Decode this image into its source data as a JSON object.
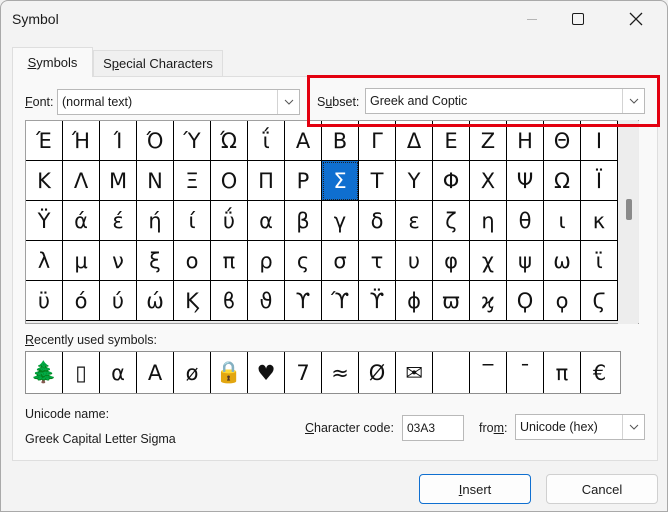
{
  "window": {
    "title": "Symbol",
    "minimize_label": "Minimize",
    "maximize_label": "Maximize",
    "close_label": "Close"
  },
  "tabs": [
    {
      "label_prefix": "",
      "label_u": "S",
      "label_rest": "ymbols",
      "active": true
    },
    {
      "label_prefix": "S",
      "label_u": "p",
      "label_rest": "ecial Characters",
      "active": false
    }
  ],
  "font": {
    "label_u": "F",
    "label_rest": "ont:",
    "value": "(normal text)"
  },
  "subset": {
    "label_prefix": "S",
    "label_u": "u",
    "label_rest": "bset:",
    "value": "Greek and Coptic",
    "highlight_color": "#e3000f"
  },
  "symbol_grid": {
    "selected_index": 24,
    "selected_color": "#0f6fd0",
    "cells": [
      "Έ",
      "Ή",
      "Ί",
      "Ό",
      "Ύ",
      "Ώ",
      "ΐ",
      "Α",
      "Β",
      "Γ",
      "Δ",
      "Ε",
      "Ζ",
      "Η",
      "Θ",
      "Ι",
      "Κ",
      "Λ",
      "Μ",
      "Ν",
      "Ξ",
      "Ο",
      "Π",
      "Ρ",
      "Σ",
      "Τ",
      "Υ",
      "Φ",
      "Χ",
      "Ψ",
      "Ω",
      "Ϊ",
      "Ϋ",
      "ά",
      "έ",
      "ή",
      "ί",
      "ΰ",
      "α",
      "β",
      "γ",
      "δ",
      "ε",
      "ζ",
      "η",
      "θ",
      "ι",
      "κ",
      "λ",
      "μ",
      "ν",
      "ξ",
      "ο",
      "π",
      "ρ",
      "ς",
      "σ",
      "τ",
      "υ",
      "φ",
      "χ",
      "ψ",
      "ω",
      "ϊ",
      "ϋ",
      "ό",
      "ύ",
      "ώ",
      "Ϗ",
      "ϐ",
      "ϑ",
      "ϒ",
      "ϓ",
      "ϔ",
      "ϕ",
      "ϖ",
      "ϗ",
      "Ϙ",
      "ϙ",
      "Ϛ"
    ]
  },
  "recent": {
    "label_u": "R",
    "label_rest": "ecently used symbols:",
    "symbols": [
      "🌲",
      "▯",
      "α",
      "A",
      "ø",
      "🔒",
      "♥",
      "7",
      "≈",
      "Ø",
      "✉",
      " ",
      "‾",
      "¯",
      "π",
      "€"
    ]
  },
  "unicode": {
    "name_label": "Unicode name:",
    "name_value": "Greek Capital Letter Sigma"
  },
  "char_code": {
    "label_u": "C",
    "label_rest": "haracter code:",
    "value": "03A3"
  },
  "from": {
    "label_prefix": "fro",
    "label_u": "m",
    "label_rest": ":",
    "value": "Unicode (hex)"
  },
  "buttons": {
    "insert_u": "I",
    "insert_rest": "nsert",
    "cancel": "Cancel"
  }
}
